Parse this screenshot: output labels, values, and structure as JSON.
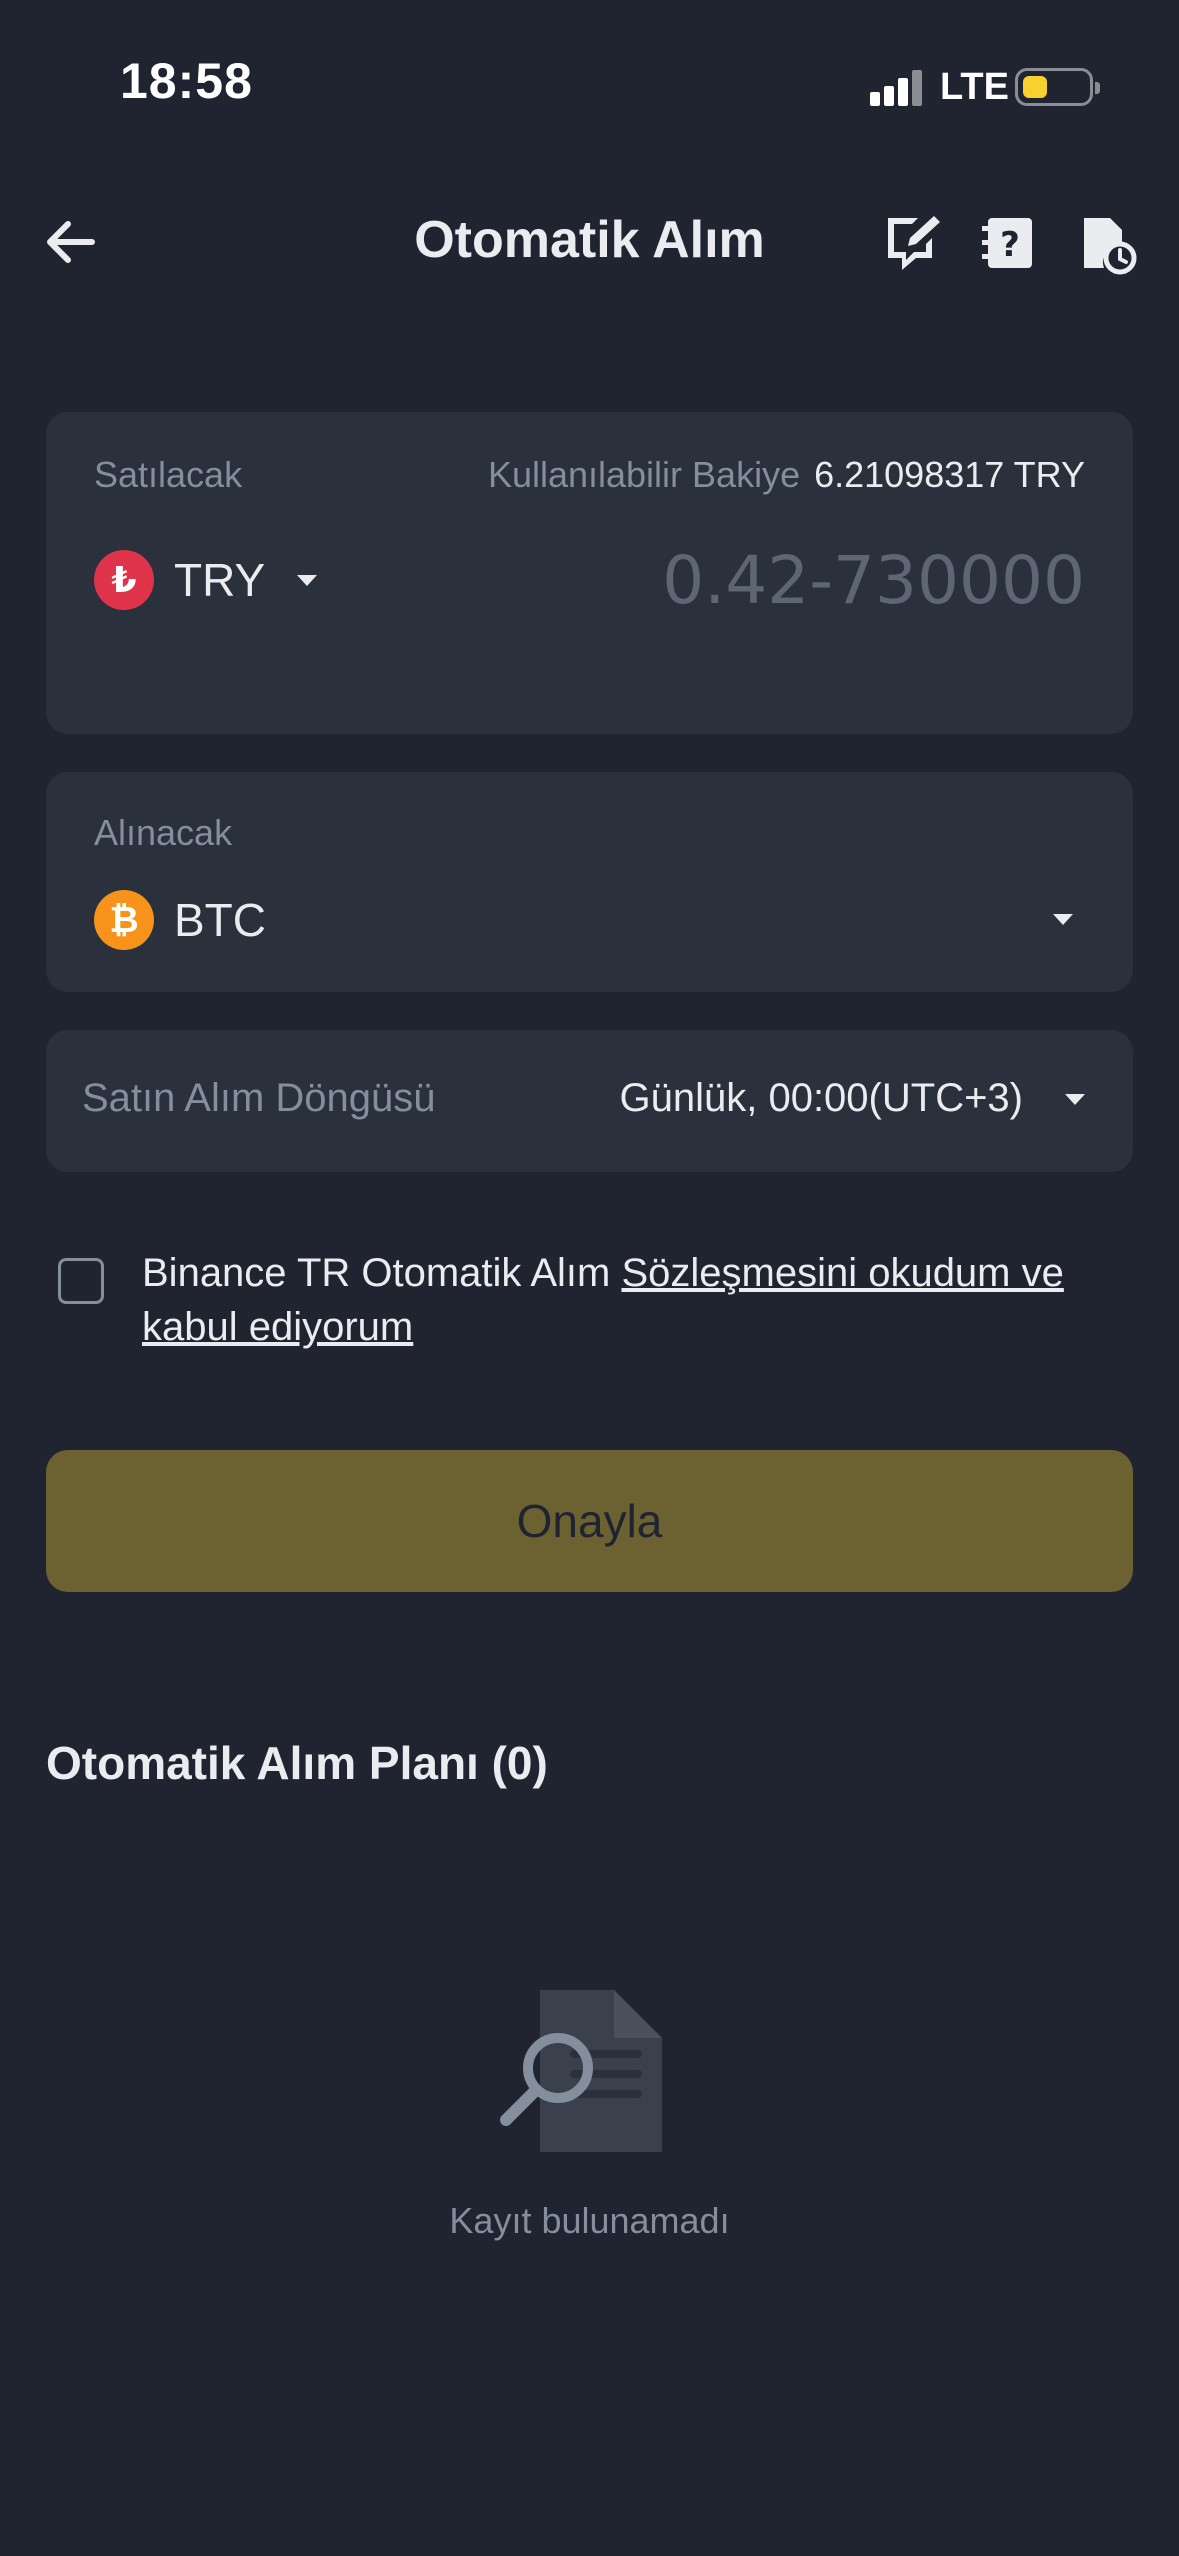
{
  "status_bar": {
    "time": "18:58",
    "network": "LTE",
    "battery_level": 0.25
  },
  "nav": {
    "title": "Otomatik Alım",
    "icons": [
      "back-arrow-icon",
      "edit-chat-icon",
      "help-book-icon",
      "history-doc-icon"
    ]
  },
  "sell": {
    "label": "Satılacak",
    "balance_label": "Kullanılabilir Bakiye",
    "balance_value": "6.21098317 TRY",
    "coin_symbol": "₺",
    "coin_name": "TRY",
    "amount_placeholder": "0.42-730000",
    "coin_color": "#e0344a"
  },
  "buy": {
    "label": "Alınacak",
    "coin_symbol": "₿",
    "coin_name": "BTC",
    "coin_color": "#f7931a"
  },
  "cycle": {
    "label": "Satın Alım Döngüsü",
    "value": "Günlük, 00:00(UTC+3)"
  },
  "terms": {
    "prefix": "Binance TR Otomatik Alım ",
    "link": "Sözleşmesini okudum ve kabul ediyorum",
    "checked": false
  },
  "confirm_label": "Onayla",
  "plan": {
    "title": "Otomatik Alım Planı (0)",
    "empty_text": "Kayıt bulunamadı"
  },
  "colors": {
    "background": "#1f2430",
    "card": "#2a303c",
    "confirm_button": "#6c6131",
    "muted_text": "#848e9c"
  }
}
